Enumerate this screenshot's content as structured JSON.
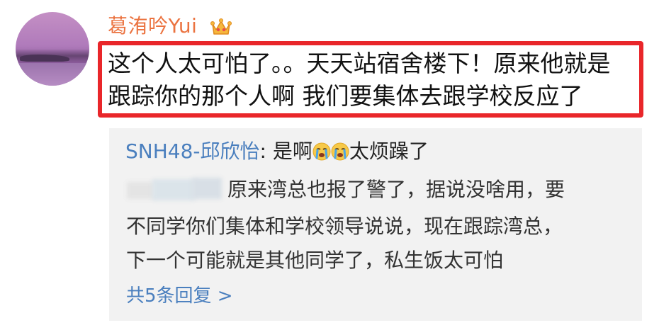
{
  "comment": {
    "username": "葛洧吟Yui",
    "badge_icon": "crown-icon",
    "text_line1": "这个人太可怕了。。天天站宿舍楼下！原来他就是",
    "text_line2": "跟踪你的那个人啊 我们要集体去跟学校反应了",
    "highlight_color": "#e9262a",
    "username_color": "#eb7340"
  },
  "reply": {
    "author": "SNH48-邱欣怡",
    "separator": ": ",
    "text_before_emoji": "是啊",
    "emoji": "crying-face-icon",
    "text_after_emoji": "太烦躁了",
    "author_color": "#4a7fbe"
  },
  "sub_reply": {
    "line1": "原来湾总也报了警了，据说没啥用，要",
    "line2": "不同学你们集体和学校领导说说，现在跟踪湾总，",
    "line3": "下一个可能就是其他同学了，私生饭太可怕"
  },
  "more": {
    "label": "共5条回复 >"
  }
}
